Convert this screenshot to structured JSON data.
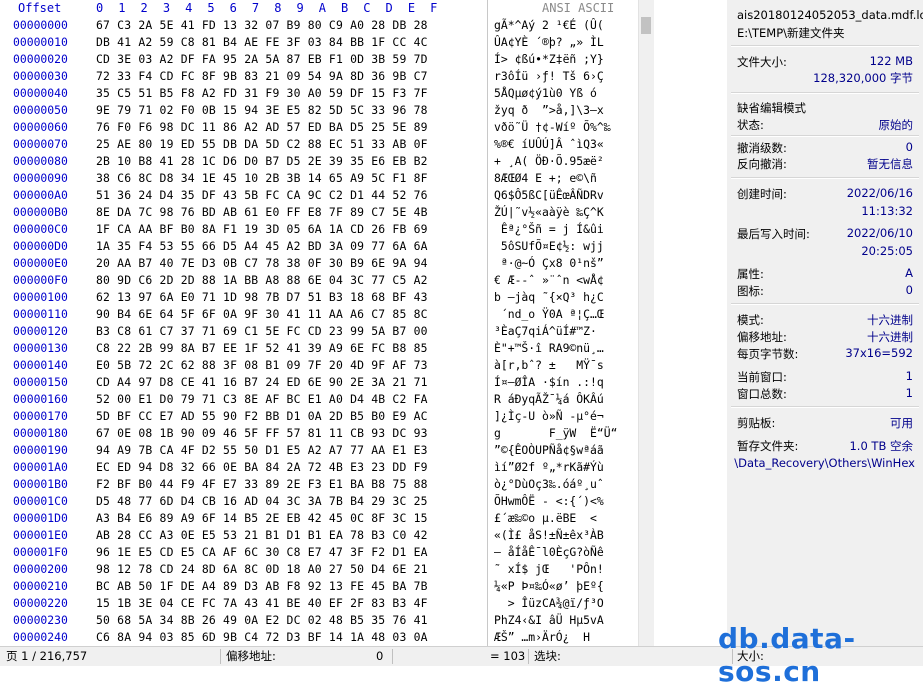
{
  "header": {
    "offset": "Offset",
    "cols": "0  1  2  3  4  5  6  7  8  9  A  B  C  D  E  F",
    "ascii": "ANSI ASCII"
  },
  "rows": [
    {
      "o": "00000000",
      "h": "67 C3 2A 5E 41 FD 13 32 07 B9 80 C9 A0 28 DB 28",
      "a": "gÃ*^Aý 2 ¹€É (Û("
    },
    {
      "o": "00000010",
      "h": "DB 41 A2 59 C8 81 B4 AE FE 3F 03 84 BB 1F CC 4C",
      "a": "ÛA¢YÈ ´®þ? „» ÌL"
    },
    {
      "o": "00000020",
      "h": "CD 3E 03 A2 DF FA 95 2A 5A 87 EB F1 0D 3B 59 7D",
      "a": "Í> ¢ßú•*Z‡ëñ ;Y}"
    },
    {
      "o": "00000030",
      "h": "72 33 F4 CD FC 8F 9B 83 21 09 54 9A 8D 36 9B C7",
      "a": "r3ôÍü ›ƒ! Tš 6›Ç"
    },
    {
      "o": "00000040",
      "h": "35 C5 51 B5 F8 A2 FD 31 F9 30 A0 59 DF 15 F3 7F",
      "a": "5ÅQµø¢ý1ù0 Yß ó"
    },
    {
      "o": "00000050",
      "h": "9E 79 71 02 F0 0B 15 94 3E E5 82 5D 5C 33 96 78",
      "a": "žyq ð  ”>å‚]\\3–x"
    },
    {
      "o": "00000060",
      "h": "76 F0 F6 98 DC 11 86 A2 AD 57 ED BA D5 25 5E 89",
      "a": "vðö˜Ü †¢-Wíº Õ%^‰"
    },
    {
      "o": "00000070",
      "h": "25 AE 80 19 ED 55 DB DA 5D C2 88 EC 51 33 AB 0F",
      "a": "%®€ íUÛÚ]Â ˆìQ3«"
    },
    {
      "o": "00000080",
      "h": "2B 10 B8 41 28 1C D6 D0 B7 D5 2E 39 35 E6 EB B2",
      "a": "+ ¸A( ÖÐ·Õ.95æë²"
    },
    {
      "o": "00000090",
      "h": "38 C6 8C D8 34 1E 45 10 2B 3B 14 65 A9 5C F1 8F",
      "a": "8ÆŒØ4 E +; e©\\ñ"
    },
    {
      "o": "000000A0",
      "h": "51 36 24 D4 35 DF 43 5B FC CA 9C C2 D1 44 52 76",
      "a": "Q6$Ô5ßC[üÊœÂÑDRv"
    },
    {
      "o": "000000B0",
      "h": "8E DA 7C 98 76 BD AB 61 E0 FF E8 7F 89 C7 5E 4B",
      "a": "ŽÚ|˜v½«aàÿè ‰Ç^K"
    },
    {
      "o": "000000C0",
      "h": "1F CA AA BF B0 8A F1 19 3D 05 6A 1A CD 26 FB 69",
      "a": " Êª¿°Šñ = j Í&ûi"
    },
    {
      "o": "000000D0",
      "h": "1A 35 F4 53 55 66 D5 A4 45 A2 BD 3A 09 77 6A 6A",
      "a": " 5ôSUfÕ¤E¢½: wjj"
    },
    {
      "o": "000000E0",
      "h": "20 AA B7 40 7E D3 0B C7 78 38 0F 30 B9 6E 9A 94",
      "a": " ª·@~Ó Çx8 0¹nš”"
    },
    {
      "o": "000000F0",
      "h": "80 9D C6 2D 2D 88 1A BB A8 88 6E 04 3C 77 C5 A2",
      "a": "€ Æ--ˆ »¨ˆn <wÅ¢"
    },
    {
      "o": "00000100",
      "h": "62 13 97 6A E0 71 1D 98 7B D7 51 B3 18 68 BF 43",
      "a": "b —jàq ˜{×Q³ h¿C"
    },
    {
      "o": "00000110",
      "h": "90 B4 6E 64 5F 6F 0A 9F 30 41 11 AA A6 C7 85 8C",
      "a": " ´nd_o Ÿ0A ª¦Ç…Œ"
    },
    {
      "o": "00000120",
      "h": "B3 C8 61 C7 37 71 69 C1 5E FC CD 23 99 5A B7 00",
      "a": "³ÈaÇ7qiÁ^üÍ#™Z· "
    },
    {
      "o": "00000130",
      "h": "C8 22 2B 99 8A B7 EE 1F 52 41 39 A9 6E FC B8 85",
      "a": "È\"+™Š·î RA9©nü¸…"
    },
    {
      "o": "00000140",
      "h": "E0 5B 72 2C 62 88 3F 08 B1 09 7F 20 4D 9F AF 73",
      "a": "à[r,bˆ? ±   MŸ¯s"
    },
    {
      "o": "00000150",
      "h": "CD A4 97 D8 CE 41 16 B7 24 ED 6E 90 2E 3A 21 71",
      "a": "Í¤—ØÎA ·$ín .:!q"
    },
    {
      "o": "00000160",
      "h": "52 00 E1 D0 79 71 C3 8E AF BC E1 A0 D4 4B C2 FA",
      "a": "R áÐyqÃŽ¯¼á ÔKÂú"
    },
    {
      "o": "00000170",
      "h": "5D BF CC E7 AD 55 90 F2 BB D1 0A 2D B5 B0 E9 AC",
      "a": "]¿Ìç-U ò»Ñ -µ°é¬"
    },
    {
      "o": "00000180",
      "h": "67 0E 08 1B 90 09 46 5F FF 57 81 11 CB 93 DC 93",
      "a": "g       F_ÿW  Ë“Ü“"
    },
    {
      "o": "00000190",
      "h": "94 A9 7B CA 4F D2 55 50 D1 E5 A2 A7 77 AA E1 E3",
      "a": "”©{ÊOÒUPÑå¢§wªáã"
    },
    {
      "o": "000001A0",
      "h": "EC ED 94 D8 32 66 0E BA 84 2A 72 4B E3 23 DD F9",
      "a": "ìí”Ø2f º„*rKã#Ýù"
    },
    {
      "o": "000001B0",
      "h": "F2 BF B0 44 F9 4F E7 33 89 2E F3 E1 BA B8 75 88",
      "a": "ò¿°DùOç3‰.óáº¸uˆ"
    },
    {
      "o": "000001C0",
      "h": "D5 48 77 6D D4 CB 16 AD 04 3C 3A 7B B4 29 3C 25",
      "a": "ÕHwmÔË - <:{´)<%"
    },
    {
      "o": "000001D0",
      "h": "A3 B4 E6 89 A9 6F 14 B5 2E EB 42 45 0C 8F 3C 15",
      "a": "£´æ‰©o µ.ëBE  <"
    },
    {
      "o": "000001E0",
      "h": "AB 28 CC A3 0E E5 53 21 B1 D1 B1 EA 78 B3 C0 42",
      "a": "«(Ì£ åS!±Ñ±êx³ÀB"
    },
    {
      "o": "000001F0",
      "h": "96 1E E5 CD E5 CA AF 6C 30 C8 E7 47 3F F2 D1 EA",
      "a": "– åÍåÊ¯l0ÈçG?òÑê"
    },
    {
      "o": "00000200",
      "h": "98 12 78 CD 24 8D 6A 8C 0D 18 A0 27 50 D4 6E 21",
      "a": "˜ xÍ$ jŒ   'PÔn!"
    },
    {
      "o": "00000210",
      "h": "BC AB 50 1F DE A4 89 D3 AB F8 92 13 FE 45 BA 7B",
      "a": "¼«P Þ¤‰Ó«ø’ þEº{"
    },
    {
      "o": "00000220",
      "h": "15 1B 3E 04 CE FC 7A 43 41 BE 40 EF 2F 83 B3 4F",
      "a": "  > ÎüzCA¾@ï/ƒ³O"
    },
    {
      "o": "00000230",
      "h": "50 68 5A 34 8B 26 49 0A E2 DC 02 48 B5 35 76 41",
      "a": "PhZ4‹&I âÜ Hµ5vA"
    },
    {
      "o": "00000240",
      "h": "C6 8A 94 03 85 6D 9B C4 72 D3 BF 14 1A 48 03 0A",
      "a": "ÆŠ” …m›ÄrÓ¿  H"
    }
  ],
  "panel": {
    "filename": "ais20180124052053_data.mdf.lo",
    "path": "E:\\TEMP\\新建文件夹",
    "size_label": "文件大小:",
    "size_mb": "122 MB",
    "size_bytes": "128,320,000 字节",
    "edit_mode": "缺省编辑模式",
    "state_label": "状态:",
    "state_value": "原始的",
    "undo_label": "撤消级数:",
    "undo_value": "0",
    "redo_label": "反向撤消:",
    "redo_value": "暂无信息",
    "created_label": "创建时间:",
    "created_date": "2022/06/16",
    "created_time": "11:13:32",
    "written_label": "最后写入时间:",
    "written_date": "2022/06/10",
    "written_time": "20:25:05",
    "attr_label": "属性:",
    "attr_value": "A",
    "icon_label": "图标:",
    "icon_value": "0",
    "mode_label": "模式:",
    "mode_value": "十六进制",
    "offsetaddr_label": "偏移地址:",
    "offsetaddr_value": "十六进制",
    "bpp_label": "每页字节数:",
    "bpp_value": "37x16=592",
    "curwin_label": "当前窗口:",
    "curwin_value": "1",
    "wintotal_label": "窗口总数:",
    "wintotal_value": "1",
    "clip_label": "剪贴板:",
    "clip_value": "可用",
    "temp_label": "暂存文件夹:",
    "temp_value": "1.0 TB 空余",
    "temp_path": "\\Data_Recovery\\Others\\WinHex"
  },
  "status": {
    "page": "页 1 / 216,757",
    "offset_label": "偏移地址:",
    "offset_value": "0",
    "eq": "= 103",
    "select_label": "选块:",
    "size_label": "大小:"
  },
  "watermark": "db.data-sos.cn"
}
